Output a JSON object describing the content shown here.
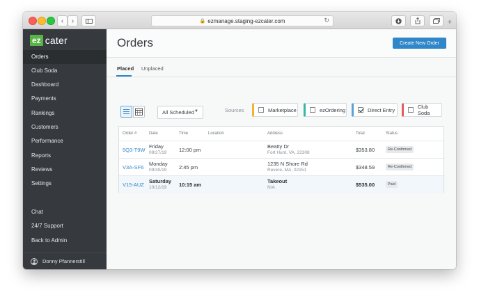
{
  "browser": {
    "url": "ezmanage.staging-ezcater.com"
  },
  "brand": {
    "ez": "ez",
    "cater": "cater",
    "color": "#5ab346"
  },
  "sidebar": {
    "items": [
      {
        "label": "Orders"
      },
      {
        "label": "Club Soda"
      },
      {
        "label": "Dashboard"
      },
      {
        "label": "Payments"
      },
      {
        "label": "Rankings"
      },
      {
        "label": "Customers"
      },
      {
        "label": "Performance"
      },
      {
        "label": "Reports"
      },
      {
        "label": "Reviews"
      },
      {
        "label": "Settings"
      }
    ],
    "bottom_items": [
      {
        "label": "Chat"
      },
      {
        "label": "24/7 Support"
      },
      {
        "label": "Back to Admin"
      }
    ],
    "user_name": "Donny Pfannerstill"
  },
  "header": {
    "title": "Orders",
    "create_button": "Create New Order",
    "accent": "#2f86c9"
  },
  "tabs": [
    {
      "label": "Placed",
      "active": true
    },
    {
      "label": "Unplaced",
      "active": false
    }
  ],
  "filters": {
    "schedule_select": "All Scheduled",
    "sources_label": "Sources",
    "sources": [
      {
        "label": "Marketplace",
        "checked": false,
        "color": "#f2b233"
      },
      {
        "label": "ezOrdering",
        "checked": false,
        "color": "#36b6a4"
      },
      {
        "label": "Direct Entry",
        "checked": true,
        "color": "#5b9fd6"
      },
      {
        "label": "Club Soda",
        "checked": false,
        "color": "#e35d5d"
      }
    ]
  },
  "table": {
    "columns": [
      "Order #",
      "Date",
      "Time",
      "Location",
      "Address",
      "Total",
      "Status"
    ],
    "rows": [
      {
        "order": "5Q3-T9W",
        "day": "Friday",
        "date": "09/27/19",
        "time": "12:00 pm",
        "location": "",
        "address1": "Beatty Dr",
        "address2": "Fort Hunt, VA, 22308",
        "total": "$353.80",
        "status": "Re-Confirmed"
      },
      {
        "order": "V3A-SF6",
        "day": "Monday",
        "date": "09/30/19",
        "time": "2:45 pm",
        "location": "",
        "address1": "1235 N Shore Rd",
        "address2": "Revere, MA, 02151",
        "total": "$348.59",
        "status": "Re-Confirmed"
      },
      {
        "order": "V15-AUZ",
        "day": "Saturday",
        "date": "10/12/19",
        "time": "10:15 am",
        "location": "",
        "address1": "Takeout",
        "address2": "N/A",
        "total": "$535.00",
        "status": "Paid"
      }
    ]
  }
}
